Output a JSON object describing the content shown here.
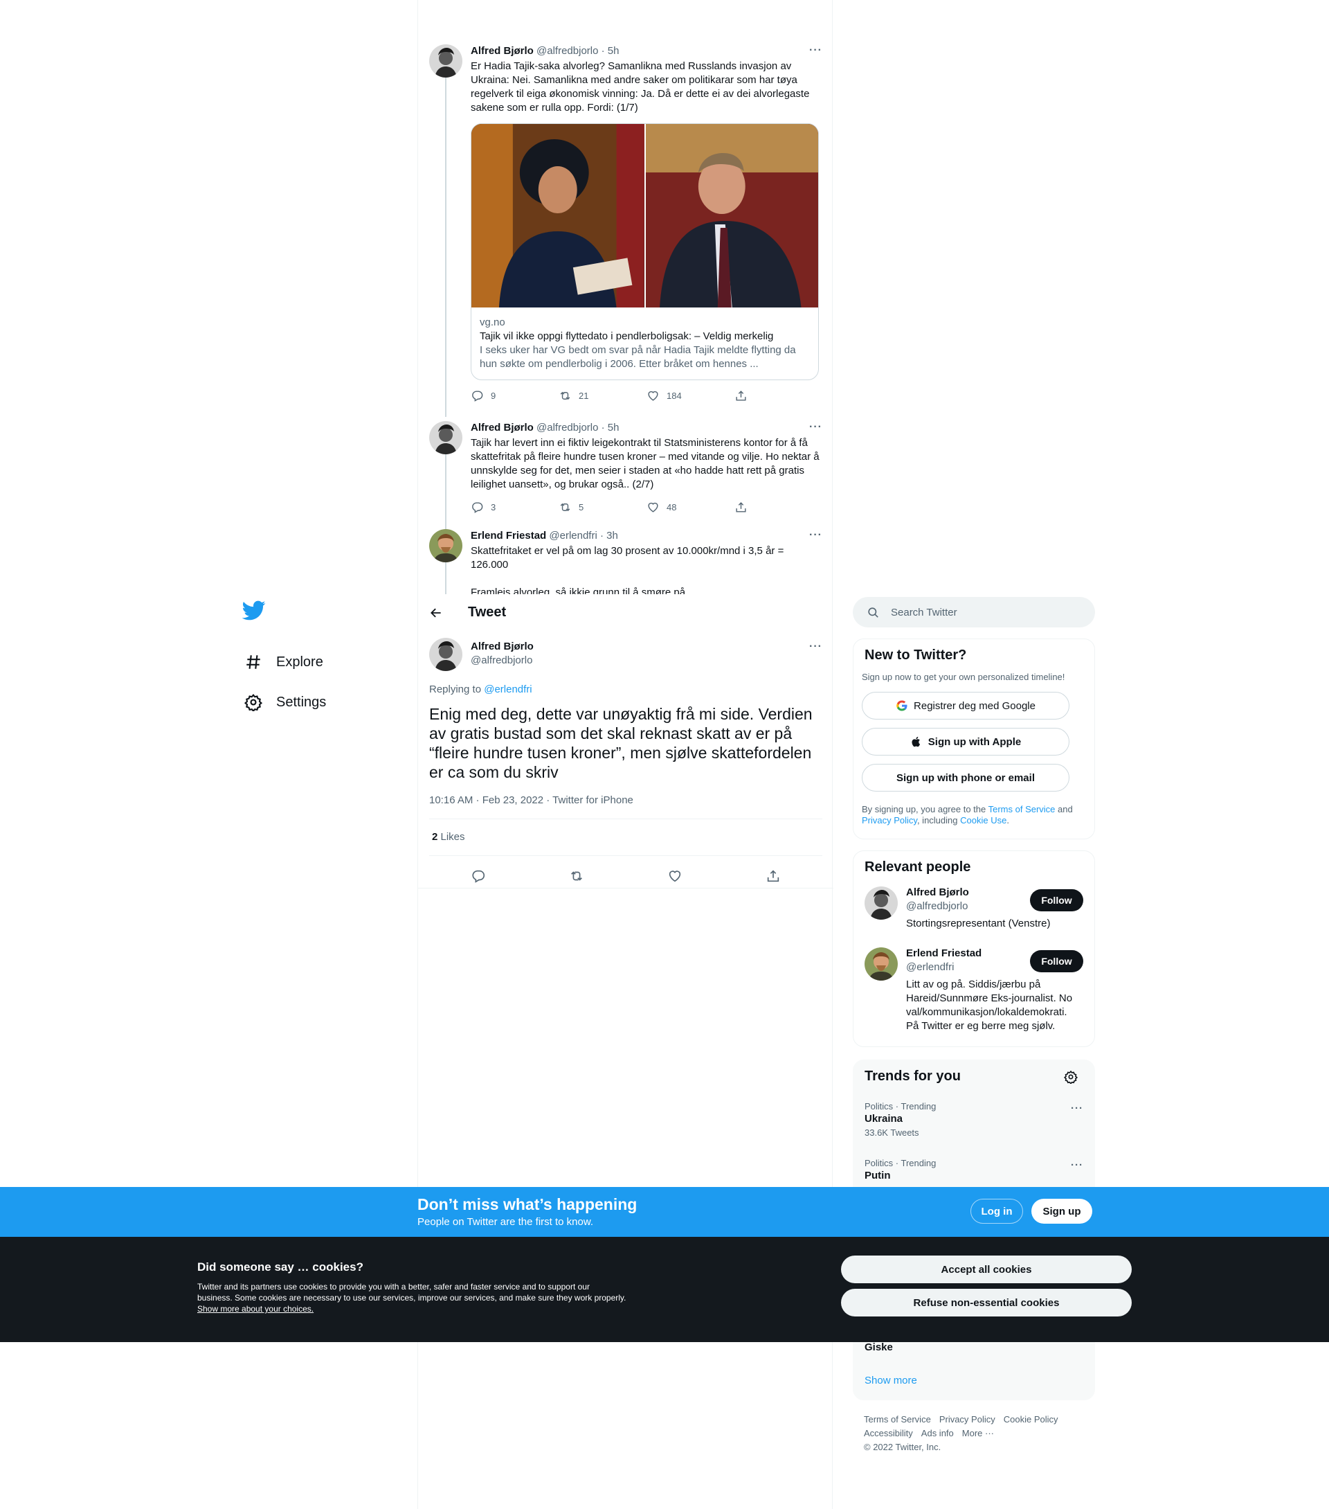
{
  "nav": {
    "explore": "Explore",
    "settings": "Settings"
  },
  "thread": [
    {
      "name": "Alfred Bjørlo",
      "handle": "@alfredbjorlo",
      "time": "· 5h",
      "text": "Er Hadia Tajik-saka alvorleg? Samanlikna med Russlands invasjon av Ukraina: Nei. Samanlikna med andre saker om politikarar som har tøya regelverk til eiga økonomisk vinning: Ja. Då er dette ei av dei alvorlegaste sakene som er rulla opp. Fordi: (1/7)",
      "card": {
        "domain": "vg.no",
        "title": "Tajik vil ikke oppgi flyttedato i pendlerboligsak: – Veldig merkelig",
        "desc": "I seks uker har VG bedt om svar på når Hadia Tajik meldte flytting da hun søkte om pendlerbolig i 2006. Etter bråket om hennes ..."
      },
      "replies": "9",
      "retweets": "21",
      "likes": "184"
    },
    {
      "name": "Alfred Bjørlo",
      "handle": "@alfredbjorlo",
      "time": "· 5h",
      "text": "Tajik har levert inn ei fiktiv leigekontrakt til Statsministerens kontor for å få skattefritak på fleire hundre tusen kroner – med vitande og vilje. Ho nektar å unnskylde seg for det, men seier i staden at «ho hadde hatt rett på gratis leilighet uansett», og brukar også.. (2/7)",
      "replies": "3",
      "retweets": "5",
      "likes": "48"
    },
    {
      "name": "Erlend Friestad",
      "handle": "@erlendfri",
      "time": "· 3h",
      "text1": "Skattefritaket er vel på om lag 30 prosent av 10.000kr/mnd i 3,5 år = 126.000",
      "text2": "Framleis alvorleg, så ikkje grunn til å smøre på"
    }
  ],
  "header": {
    "title": "Tweet"
  },
  "focus": {
    "name": "Alfred Bjørlo",
    "handle": "@alfredbjorlo",
    "replying_prefix": "Replying to ",
    "replying_to": "@erlendfri",
    "text": "Enig med deg, dette var unøyaktig frå mi side. Verdien av gratis bustad som det skal reknast skatt av er på “fleire hundre tusen kroner”, men sjølve skattefordelen er ca som du skriv",
    "timestamp": "10:16 AM · Feb 23, 2022 · Twitter for iPhone",
    "likes_count": "2",
    "likes_label": " Likes"
  },
  "search": {
    "placeholder": "Search Twitter"
  },
  "new_to_twitter": {
    "title": "New to Twitter?",
    "subtitle": "Sign up now to get your own personalized timeline!",
    "google": "Registrer deg med Google",
    "apple": "Sign up with Apple",
    "phone": "Sign up with phone or email",
    "legal_1": "By signing up, you agree to the ",
    "legal_tos": "Terms of Service",
    "legal_2": " and ",
    "legal_pp": "Privacy Policy",
    "legal_3": ", including ",
    "legal_cu": "Cookie Use",
    "legal_4": "."
  },
  "relevant": {
    "title": "Relevant people",
    "people": [
      {
        "name": "Alfred Bjørlo",
        "handle": "@alfredbjorlo",
        "bio": "Stortingsrepresentant (Venstre)",
        "button": "Follow"
      },
      {
        "name": "Erlend Friestad",
        "handle": "@erlendfri",
        "bio": "Litt av og på. Siddis/jærbu på Hareid/Sunnmøre Eks-journalist. No val/kommunikasjon/lokaldemokrati. På Twitter er eg berre meg sjølv.",
        "button": "Follow"
      }
    ]
  },
  "trends": {
    "title": "Trends for you",
    "items": [
      {
        "context": "Politics · Trending",
        "name": "Ukraina",
        "count": "33.6K Tweets"
      },
      {
        "context": "Politics · Trending",
        "name": "Putin",
        "count": ""
      }
    ],
    "partial": "Giske",
    "show_more": "Show more"
  },
  "footer": {
    "tos": "Terms of Service",
    "privacy": "Privacy Policy",
    "cookie": "Cookie Policy",
    "accessibility": "Accessibility",
    "ads": "Ads info",
    "more": "More ···",
    "copyright": "© 2022 Twitter, Inc."
  },
  "banner": {
    "title": "Don’t miss what’s happening",
    "subtitle": "People on Twitter are the first to know.",
    "login": "Log in",
    "signup": "Sign up"
  },
  "cookies": {
    "title": "Did someone say … cookies?",
    "desc": "Twitter and its partners use cookies to provide you with a better, safer and faster service and to support our business. Some cookies are necessary to use our services, improve our services, and make sure they work properly. ",
    "link": "Show more about your choices.",
    "accept": "Accept all cookies",
    "refuse": "Refuse non-essential cookies"
  },
  "colors": {
    "accent": "#1d9bf0",
    "text": "#0f1419",
    "muted": "#536471",
    "dark": "#14191e"
  }
}
